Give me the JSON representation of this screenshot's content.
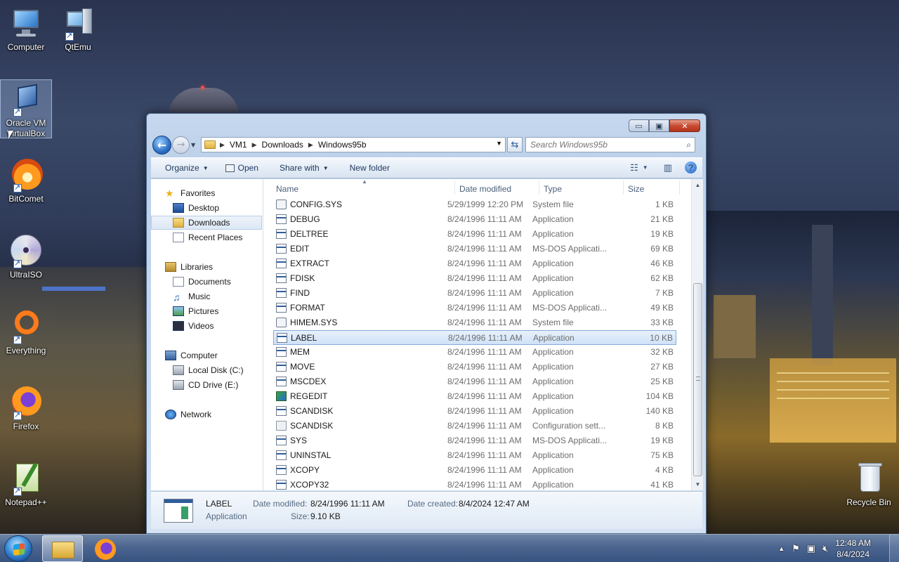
{
  "desktop": {
    "icons": [
      {
        "label": "Computer"
      },
      {
        "label": "QtEmu"
      },
      {
        "label": "Oracle VM VirtualBox"
      },
      {
        "label": "BitComet"
      },
      {
        "label": "UltraISO"
      },
      {
        "label": "Everything"
      },
      {
        "label": "Firefox"
      },
      {
        "label": "Notepad++"
      },
      {
        "label": "Recycle Bin"
      }
    ]
  },
  "window": {
    "buttons": {
      "minimize": "▭",
      "maximize": "▣",
      "close": "✕"
    },
    "breadcrumb": [
      "VM1",
      "Downloads",
      "Windows95b"
    ],
    "search_placeholder": "Search Windows95b",
    "toolbar": {
      "organize": "Organize",
      "open": "Open",
      "share_with": "Share with",
      "new_folder": "New folder"
    },
    "nav": {
      "favorites": "Favorites",
      "desktop": "Desktop",
      "downloads": "Downloads",
      "recent": "Recent Places",
      "libraries": "Libraries",
      "documents": "Documents",
      "music": "Music",
      "pictures": "Pictures",
      "videos": "Videos",
      "computer": "Computer",
      "local_disk": "Local Disk (C:)",
      "cd_drive": "CD Drive (E:)",
      "network": "Network"
    },
    "columns": {
      "name": "Name",
      "date": "Date modified",
      "type": "Type",
      "size": "Size"
    },
    "files": [
      {
        "name": "CONFIG.SYS",
        "date": "5/29/1999 12:20 PM",
        "type": "System file",
        "size": "1 KB"
      },
      {
        "name": "DEBUG",
        "date": "8/24/1996 11:11 AM",
        "type": "Application",
        "size": "21 KB"
      },
      {
        "name": "DELTREE",
        "date": "8/24/1996 11:11 AM",
        "type": "Application",
        "size": "19 KB"
      },
      {
        "name": "EDIT",
        "date": "8/24/1996 11:11 AM",
        "type": "MS-DOS Applicati...",
        "size": "69 KB"
      },
      {
        "name": "EXTRACT",
        "date": "8/24/1996 11:11 AM",
        "type": "Application",
        "size": "46 KB"
      },
      {
        "name": "FDISK",
        "date": "8/24/1996 11:11 AM",
        "type": "Application",
        "size": "62 KB"
      },
      {
        "name": "FIND",
        "date": "8/24/1996 11:11 AM",
        "type": "Application",
        "size": "7 KB"
      },
      {
        "name": "FORMAT",
        "date": "8/24/1996 11:11 AM",
        "type": "MS-DOS Applicati...",
        "size": "49 KB"
      },
      {
        "name": "HIMEM.SYS",
        "date": "8/24/1996 11:11 AM",
        "type": "System file",
        "size": "33 KB"
      },
      {
        "name": "LABEL",
        "date": "8/24/1996 11:11 AM",
        "type": "Application",
        "size": "10 KB"
      },
      {
        "name": "MEM",
        "date": "8/24/1996 11:11 AM",
        "type": "Application",
        "size": "32 KB"
      },
      {
        "name": "MOVE",
        "date": "8/24/1996 11:11 AM",
        "type": "Application",
        "size": "27 KB"
      },
      {
        "name": "MSCDEX",
        "date": "8/24/1996 11:11 AM",
        "type": "Application",
        "size": "25 KB"
      },
      {
        "name": "REGEDIT",
        "date": "8/24/1996 11:11 AM",
        "type": "Application",
        "size": "104 KB"
      },
      {
        "name": "SCANDISK",
        "date": "8/24/1996 11:11 AM",
        "type": "Application",
        "size": "140 KB"
      },
      {
        "name": "SCANDISK",
        "date": "8/24/1996 11:11 AM",
        "type": "Configuration sett...",
        "size": "8 KB"
      },
      {
        "name": "SYS",
        "date": "8/24/1996 11:11 AM",
        "type": "MS-DOS Applicati...",
        "size": "19 KB"
      },
      {
        "name": "UNINSTAL",
        "date": "8/24/1996 11:11 AM",
        "type": "Application",
        "size": "75 KB"
      },
      {
        "name": "XCOPY",
        "date": "8/24/1996 11:11 AM",
        "type": "Application",
        "size": "4 KB"
      },
      {
        "name": "XCOPY32",
        "date": "8/24/1996 11:11 AM",
        "type": "Application",
        "size": "41 KB"
      }
    ],
    "details": {
      "name": "LABEL",
      "kind": "Application",
      "date_modified_label": "Date modified:",
      "date_modified": "8/24/1996 11:11 AM",
      "date_created_label": "Date created:",
      "date_created": "8/4/2024 12:47 AM",
      "size_label": "Size:",
      "size": "9.10 KB"
    }
  },
  "taskbar": {
    "clock_time": "12:48 AM",
    "clock_date": "8/4/2024"
  }
}
